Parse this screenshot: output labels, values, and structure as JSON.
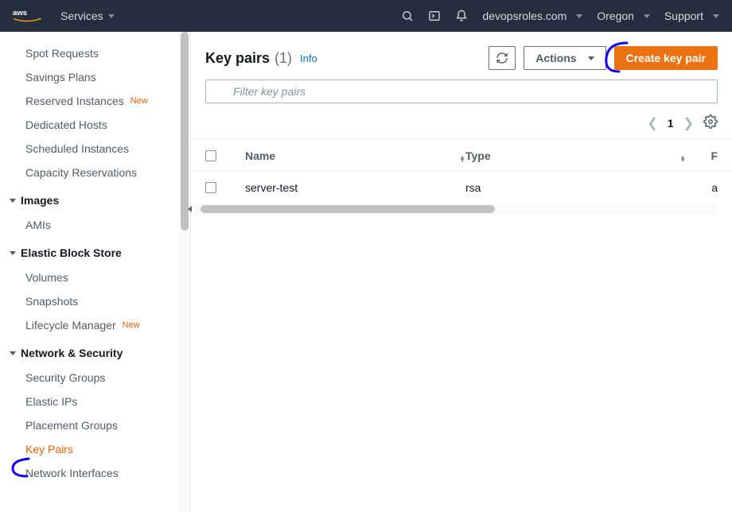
{
  "topnav": {
    "services_label": "Services",
    "account": "devopsroles.com",
    "region": "Oregon",
    "support": "Support"
  },
  "sidebar": {
    "loose_items": [
      {
        "label": "Spot Requests"
      },
      {
        "label": "Savings Plans"
      },
      {
        "label": "Reserved Instances",
        "new": true
      },
      {
        "label": "Dedicated Hosts"
      },
      {
        "label": "Scheduled Instances"
      },
      {
        "label": "Capacity Reservations"
      }
    ],
    "groups": [
      {
        "title": "Images",
        "items": [
          {
            "label": "AMIs"
          }
        ]
      },
      {
        "title": "Elastic Block Store",
        "items": [
          {
            "label": "Volumes"
          },
          {
            "label": "Snapshots"
          },
          {
            "label": "Lifecycle Manager",
            "new": true
          }
        ]
      },
      {
        "title": "Network & Security",
        "items": [
          {
            "label": "Security Groups"
          },
          {
            "label": "Elastic IPs"
          },
          {
            "label": "Placement Groups"
          },
          {
            "label": "Key Pairs",
            "active": true
          },
          {
            "label": "Network Interfaces"
          }
        ]
      }
    ],
    "new_badge": "New"
  },
  "page": {
    "title": "Key pairs",
    "count": "(1)",
    "info": "Info",
    "actions_label": "Actions",
    "create_label": "Create key pair",
    "filter_placeholder": "Filter key pairs",
    "page_number": "1",
    "columns": {
      "name": "Name",
      "type": "Type"
    },
    "rows": [
      {
        "name": "server-test",
        "type": "rsa",
        "trailing": "a"
      }
    ],
    "trailing_header": "F"
  }
}
